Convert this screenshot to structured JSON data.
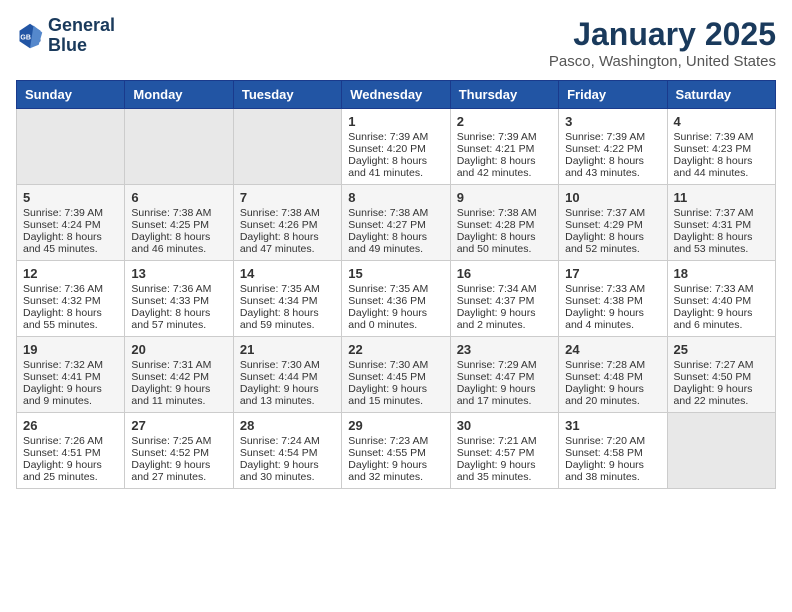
{
  "logo": {
    "line1": "General",
    "line2": "Blue"
  },
  "title": "January 2025",
  "location": "Pasco, Washington, United States",
  "weekdays": [
    "Sunday",
    "Monday",
    "Tuesday",
    "Wednesday",
    "Thursday",
    "Friday",
    "Saturday"
  ],
  "weeks": [
    [
      {
        "day": "",
        "info": ""
      },
      {
        "day": "",
        "info": ""
      },
      {
        "day": "",
        "info": ""
      },
      {
        "day": "1",
        "info": "Sunrise: 7:39 AM\nSunset: 4:20 PM\nDaylight: 8 hours and 41 minutes."
      },
      {
        "day": "2",
        "info": "Sunrise: 7:39 AM\nSunset: 4:21 PM\nDaylight: 8 hours and 42 minutes."
      },
      {
        "day": "3",
        "info": "Sunrise: 7:39 AM\nSunset: 4:22 PM\nDaylight: 8 hours and 43 minutes."
      },
      {
        "day": "4",
        "info": "Sunrise: 7:39 AM\nSunset: 4:23 PM\nDaylight: 8 hours and 44 minutes."
      }
    ],
    [
      {
        "day": "5",
        "info": "Sunrise: 7:39 AM\nSunset: 4:24 PM\nDaylight: 8 hours and 45 minutes."
      },
      {
        "day": "6",
        "info": "Sunrise: 7:38 AM\nSunset: 4:25 PM\nDaylight: 8 hours and 46 minutes."
      },
      {
        "day": "7",
        "info": "Sunrise: 7:38 AM\nSunset: 4:26 PM\nDaylight: 8 hours and 47 minutes."
      },
      {
        "day": "8",
        "info": "Sunrise: 7:38 AM\nSunset: 4:27 PM\nDaylight: 8 hours and 49 minutes."
      },
      {
        "day": "9",
        "info": "Sunrise: 7:38 AM\nSunset: 4:28 PM\nDaylight: 8 hours and 50 minutes."
      },
      {
        "day": "10",
        "info": "Sunrise: 7:37 AM\nSunset: 4:29 PM\nDaylight: 8 hours and 52 minutes."
      },
      {
        "day": "11",
        "info": "Sunrise: 7:37 AM\nSunset: 4:31 PM\nDaylight: 8 hours and 53 minutes."
      }
    ],
    [
      {
        "day": "12",
        "info": "Sunrise: 7:36 AM\nSunset: 4:32 PM\nDaylight: 8 hours and 55 minutes."
      },
      {
        "day": "13",
        "info": "Sunrise: 7:36 AM\nSunset: 4:33 PM\nDaylight: 8 hours and 57 minutes."
      },
      {
        "day": "14",
        "info": "Sunrise: 7:35 AM\nSunset: 4:34 PM\nDaylight: 8 hours and 59 minutes."
      },
      {
        "day": "15",
        "info": "Sunrise: 7:35 AM\nSunset: 4:36 PM\nDaylight: 9 hours and 0 minutes."
      },
      {
        "day": "16",
        "info": "Sunrise: 7:34 AM\nSunset: 4:37 PM\nDaylight: 9 hours and 2 minutes."
      },
      {
        "day": "17",
        "info": "Sunrise: 7:33 AM\nSunset: 4:38 PM\nDaylight: 9 hours and 4 minutes."
      },
      {
        "day": "18",
        "info": "Sunrise: 7:33 AM\nSunset: 4:40 PM\nDaylight: 9 hours and 6 minutes."
      }
    ],
    [
      {
        "day": "19",
        "info": "Sunrise: 7:32 AM\nSunset: 4:41 PM\nDaylight: 9 hours and 9 minutes."
      },
      {
        "day": "20",
        "info": "Sunrise: 7:31 AM\nSunset: 4:42 PM\nDaylight: 9 hours and 11 minutes."
      },
      {
        "day": "21",
        "info": "Sunrise: 7:30 AM\nSunset: 4:44 PM\nDaylight: 9 hours and 13 minutes."
      },
      {
        "day": "22",
        "info": "Sunrise: 7:30 AM\nSunset: 4:45 PM\nDaylight: 9 hours and 15 minutes."
      },
      {
        "day": "23",
        "info": "Sunrise: 7:29 AM\nSunset: 4:47 PM\nDaylight: 9 hours and 17 minutes."
      },
      {
        "day": "24",
        "info": "Sunrise: 7:28 AM\nSunset: 4:48 PM\nDaylight: 9 hours and 20 minutes."
      },
      {
        "day": "25",
        "info": "Sunrise: 7:27 AM\nSunset: 4:50 PM\nDaylight: 9 hours and 22 minutes."
      }
    ],
    [
      {
        "day": "26",
        "info": "Sunrise: 7:26 AM\nSunset: 4:51 PM\nDaylight: 9 hours and 25 minutes."
      },
      {
        "day": "27",
        "info": "Sunrise: 7:25 AM\nSunset: 4:52 PM\nDaylight: 9 hours and 27 minutes."
      },
      {
        "day": "28",
        "info": "Sunrise: 7:24 AM\nSunset: 4:54 PM\nDaylight: 9 hours and 30 minutes."
      },
      {
        "day": "29",
        "info": "Sunrise: 7:23 AM\nSunset: 4:55 PM\nDaylight: 9 hours and 32 minutes."
      },
      {
        "day": "30",
        "info": "Sunrise: 7:21 AM\nSunset: 4:57 PM\nDaylight: 9 hours and 35 minutes."
      },
      {
        "day": "31",
        "info": "Sunrise: 7:20 AM\nSunset: 4:58 PM\nDaylight: 9 hours and 38 minutes."
      },
      {
        "day": "",
        "info": ""
      }
    ]
  ]
}
